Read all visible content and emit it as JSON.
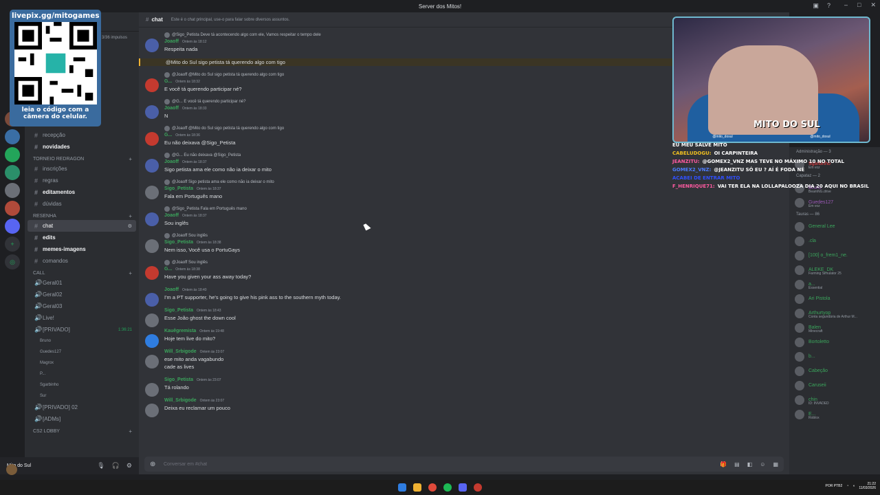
{
  "window": {
    "title": "Server dos Mitos!"
  },
  "channels_header": {
    "boosts": "3/36 impulsos"
  },
  "channel_list": [
    {
      "type": "channel",
      "name": "recepção",
      "state": "normal"
    },
    {
      "type": "channel",
      "name": "novidades",
      "state": "unread"
    },
    {
      "type": "category",
      "name": "TORNEIO REDRAGON"
    },
    {
      "type": "channel",
      "name": "inscrições",
      "state": "normal"
    },
    {
      "type": "channel",
      "name": "regras",
      "state": "normal"
    },
    {
      "type": "channel",
      "name": "editamentos",
      "state": "unread"
    },
    {
      "type": "channel",
      "name": "dúvidas",
      "state": "normal"
    },
    {
      "type": "category",
      "name": "RESENHA"
    },
    {
      "type": "channel",
      "name": "chat",
      "state": "active"
    },
    {
      "type": "channel",
      "name": "edits",
      "state": "unread"
    },
    {
      "type": "channel",
      "name": "memes-imagens",
      "state": "unread"
    },
    {
      "type": "channel",
      "name": "comandos",
      "state": "normal"
    },
    {
      "type": "category",
      "name": "CALL"
    },
    {
      "type": "voice",
      "name": "Geral01"
    },
    {
      "type": "voice",
      "name": "Geral02"
    },
    {
      "type": "voice",
      "name": "Geral03"
    },
    {
      "type": "voice",
      "name": "Live!"
    },
    {
      "type": "voice",
      "name": "[PRIVADO]",
      "timer": "1:36:21"
    },
    {
      "type": "vuser",
      "name": "Bruno"
    },
    {
      "type": "vuser",
      "name": "Guedes127"
    },
    {
      "type": "vuser",
      "name": "Magrox"
    },
    {
      "type": "vuser",
      "name": "P..."
    },
    {
      "type": "vuser",
      "name": "Sgarbinho"
    },
    {
      "type": "vuser",
      "name": "Sur"
    },
    {
      "type": "voice",
      "name": "[PRIVADO] 02"
    },
    {
      "type": "voice",
      "name": "[ADMs]"
    },
    {
      "type": "category",
      "name": "CS2 LOBBY"
    }
  ],
  "user_panel": {
    "name": "Mito do Sul"
  },
  "chat_header": {
    "channel": "chat",
    "topic": "Este é o chat principal, use-o para falar sobre diversos assuntos."
  },
  "messages": [
    {
      "reply": "@Sigo_Petista Deve tá acontecendo algo com ele, Vamos respeitar o tempo dele",
      "author": "Joaoff",
      "color": "#3ba55c",
      "time": "Ontem às 18:12",
      "lines": [
        "Respeita nada"
      ],
      "avatar": "#4a5fa8"
    },
    {
      "reply": "",
      "author": "",
      "color": "",
      "time": "",
      "lines": [
        "@Mito do Sul sigo petista tá querendo algo com tigo"
      ],
      "highlight": true
    },
    {
      "reply": "@Joaoff @Mito do Sul sigo petista tá querendo algo com tigo",
      "author": "G...",
      "color": "#3ba55c",
      "time": "Ontem às 18:32",
      "lines": [
        "E você tá querendo participar né?"
      ],
      "avatar": "#c43a2f"
    },
    {
      "reply": "@G... E você tá querendo participar né?",
      "author": "Joaoff",
      "color": "#3ba55c",
      "time": "Ontem às 18:33",
      "lines": [
        "N"
      ],
      "avatar": "#4a5fa8"
    },
    {
      "reply": "@Joaoff @Mito do Sul sigo petista tá querendo algo com tigo",
      "author": "G...",
      "color": "#3ba55c",
      "time": "Ontem às 18:36",
      "lines": [
        "Eu não deixava @Sigo_Petista"
      ],
      "avatar": "#c43a2f"
    },
    {
      "reply": "@G... Eu não deixava @Sigo_Petista",
      "author": "Joaoff",
      "color": "#3ba55c",
      "time": "Ontem às 18:37",
      "lines": [
        "Sigo petista ama ele como não ia deixar o mito"
      ],
      "avatar": "#4a5fa8"
    },
    {
      "reply": "@Joaoff Sigo petista ama ele como não ia deixar o mito",
      "author": "Sigo_Petista",
      "color": "#3ba55c",
      "time": "Ontem às 18:37",
      "lines": [
        "Fala em Português mano"
      ],
      "avatar": "#6b6f77"
    },
    {
      "reply": "@Sigo_Petista Fala em Português mano",
      "author": "Joaoff",
      "color": "#3ba55c",
      "time": "Ontem às 18:37",
      "lines": [
        "Sou inglês"
      ],
      "avatar": "#4a5fa8"
    },
    {
      "reply": "@Joaoff Sou inglês",
      "author": "Sigo_Petista",
      "color": "#3ba55c",
      "time": "Ontem às 18:38",
      "lines": [
        "Nem isso, Você usa o PortuGays"
      ],
      "avatar": "#6b6f77"
    },
    {
      "reply": "@Joaoff Sou inglês",
      "author": "G...",
      "color": "#3ba55c",
      "time": "Ontem às 18:38",
      "lines": [
        "Have you given your ass away today?"
      ],
      "avatar": "#c43a2f"
    },
    {
      "reply": "",
      "author": "Joaoff",
      "color": "#3ba55c",
      "time": "Ontem às 18:40",
      "lines": [
        "I'm a PT supporter, he's going to give his pink ass to the southern myth today."
      ],
      "avatar": "#4a5fa8"
    },
    {
      "reply": "",
      "author": "Sigo_Petista",
      "color": "#3ba55c",
      "time": "Ontem às 18:43",
      "lines": [
        "Esse João ghost the down cool"
      ],
      "avatar": "#6b6f77"
    },
    {
      "reply": "",
      "author": "Kauêgremista",
      "color": "#3ba55c",
      "time": "Ontem às 19:48",
      "lines": [
        "Hoje tem live do mito?"
      ],
      "avatar": "#2f7de0"
    },
    {
      "reply": "",
      "author": "Will_Srbigode",
      "color": "#3ba55c",
      "time": "Ontem às 23:07",
      "lines": [
        "ese mito anda vagabundo",
        "cade as lives"
      ],
      "avatar": "#6b6f77"
    },
    {
      "reply": "",
      "author": "Sigo_Petista",
      "color": "#3ba55c",
      "time": "Ontem às 23:07",
      "lines": [
        "Tá rolando"
      ],
      "avatar": "#6b6f77"
    },
    {
      "reply": "",
      "author": "Will_Srbigode",
      "color": "#3ba55c",
      "time": "Ontem às 23:07",
      "lines": [
        "Deixa eu reclamar um pouco"
      ],
      "avatar": "#6b6f77"
    }
  ],
  "composer": {
    "placeholder": "Conversar em #chat"
  },
  "overlay": {
    "qr_top": "livepix.gg/mitogames",
    "qr_bottom": "leia o código com a câmera do celular.",
    "cam_logo": "MITO DO SUL",
    "cam_handle_1": "@mito_dosul",
    "cam_handle_2": "@mito_dosul",
    "stream_chat": [
      {
        "user": "",
        "text": "EU MEU SALVE MITO",
        "color": "#ffffff"
      },
      {
        "user": "CABELUDOGU:",
        "text": "OI CARPINTEIRA",
        "color": "#f0c020"
      },
      {
        "user": "JEANZITU:",
        "text": "@GOMEX2_VNZ MAS TEVE NO MÁXIMO 10 NO TOTAL",
        "color": "#ff5aa0"
      },
      {
        "user": "GOMEX2_VNZ:",
        "text": "@JEANZITU SÓ EU ? AÍ É FODA NÉ",
        "color": "#4f7dff"
      },
      {
        "user": "",
        "text": "ACABEI DE ENTRAR MITO",
        "color": "#3050ff"
      },
      {
        "user": "F_HENRIQUE71:",
        "text": "VAI TER ELA NA LOLLAPALOOZA DIA 20 AQUI NO BRASIL",
        "color": "#ff5aa0"
      }
    ]
  },
  "members": [
    {
      "type": "cat",
      "name": "Administração — 3"
    },
    {
      "type": "mem",
      "name": "Sgarbinho",
      "color": "#f23f43",
      "sub": "Em voz"
    },
    {
      "type": "cat",
      "name": "Capataz — 2"
    },
    {
      "type": "mem",
      "name": "Bruno",
      "color": "#9b59b6",
      "sub": "BeamNG.drive"
    },
    {
      "type": "mem",
      "name": "Guedes127",
      "color": "#9b59b6",
      "sub": "Em voz"
    },
    {
      "type": "cat",
      "name": "Tauras — 86"
    },
    {
      "type": "mem",
      "name": "General Lee",
      "color": "#3ba55c",
      "sub": ""
    },
    {
      "type": "mem",
      "name": ".cla",
      "color": "#3ba55c",
      "sub": ""
    },
    {
      "type": "mem",
      "name": "[100] o_frem1_ne.",
      "color": "#3ba55c",
      "sub": ""
    },
    {
      "type": "mem",
      "name": "ALEKE_DK",
      "color": "#3ba55c",
      "sub": "Farming Simulator 25"
    },
    {
      "type": "mem",
      "name": "a...",
      "color": "#3ba55c",
      "sub": "Essential"
    },
    {
      "type": "mem",
      "name": "Ari Pistola",
      "color": "#3ba55c",
      "sub": ""
    },
    {
      "type": "mem",
      "name": "Arthurtyop",
      "color": "#3ba55c",
      "sub": "Conta segundária de Arthur M..."
    },
    {
      "type": "mem",
      "name": "Balen",
      "color": "#3ba55c",
      "sub": "Minecraft"
    },
    {
      "type": "mem",
      "name": "Bortoletto",
      "color": "#3ba55c",
      "sub": ""
    },
    {
      "type": "mem",
      "name": "b...",
      "color": "#3ba55c",
      "sub": ""
    },
    {
      "type": "mem",
      "name": "Cabeção",
      "color": "#3ba55c",
      "sub": ""
    },
    {
      "type": "mem",
      "name": "Caruseii",
      "color": "#3ba55c",
      "sub": ""
    },
    {
      "type": "mem",
      "name": "chin",
      "color": "#3ba55c",
      "sub": "ID: INVADED"
    },
    {
      "type": "mem",
      "name": "E...",
      "color": "#3ba55c",
      "sub": "Roblox"
    }
  ],
  "taskbar": {
    "lang": "POR PTB2",
    "time": "21:22",
    "date": "11/03/2026"
  }
}
